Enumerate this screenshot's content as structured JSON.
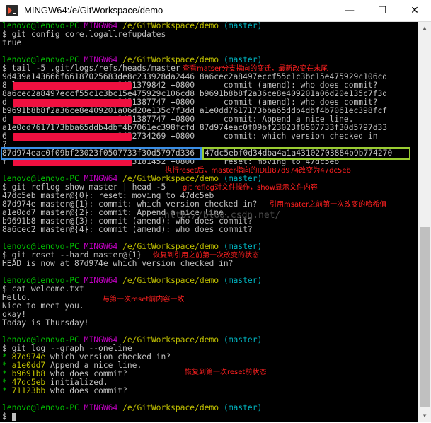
{
  "window": {
    "title": "MINGW64:/e/GitWorkspace/demo",
    "minimize": "—",
    "maximize": "☐",
    "close": "✕"
  },
  "prompt": {
    "user": "lenovo@lenovo-PC",
    "env": "MINGW64",
    "path": "/e/GitWorkspace/demo",
    "branch": "(master)",
    "symbol": "$"
  },
  "commands": {
    "c1": "git config core.logallrefupdates",
    "c2": "tail -5 .git/logs/refs/heads/master",
    "c3": "git reflog show master | head -5",
    "c4": "git reset --hard master@{1}",
    "c5": "cat welcome.txt",
    "c6": "git log --graph --oneline"
  },
  "output": {
    "o1": "true",
    "tail": [
      "9d439a143666f66187025683de8c233928da2446 8a6cec2a8497eccf55c1c3bc15e475929c106cd",
      "8 l                     1451379842 +0800      commit (amend): who does commit?",
      "8a6cec2a8497eccf55c1c3bc15e475929c106cd8 b9691b8b8f2a36ce8e409201a06d20e135c7f3d",
      "d                       1451387747 +0800      commit (amend): who does commit?",
      "b9691b8b8f2a36ce8e409201a06d20e135c7f3dd a1e0dd7617173bba65ddb4dbf4b7061ec398fcf",
      "d                       1451387747 +0800      commit: Append a nice line.",
      "a1e0dd7617173bba65ddb4dbf4b7061ec398fcfd 87d974eac0f09bf23023f0507733f30d5797d33",
      "6                       1452734269 +0800      commit: which version checked in",
      "?",
      "87d974eac0f09bf23023f0507733f30d5797d336",
      "47dc5ebf0d34dba4a1a43102703884b9b774270",
      "f                       1453181452 +0800      reset: moving to 47dc5eb"
    ],
    "reflog": [
      "47dc5eb master@{0}: reset: moving to 47dc5eb",
      "87d974e master@{1}: commit: which version checked in?",
      "a1e0dd7 master@{2}: commit: Append a nice line.",
      "b9691b8 master@{3}: commit (amend): who does commit?",
      "8a6cec2 master@{4}: commit (amend): who does commit?"
    ],
    "reset": "HEAD is now at 87d974e which version checked in?",
    "cat": [
      "Hello.",
      "Nice to meet you.",
      "okay!",
      "Today is Thursday!"
    ],
    "log": [
      {
        "hash": "87d974e",
        "msg": "which version checked in?"
      },
      {
        "hash": "a1e0dd7",
        "msg": "Append a nice line."
      },
      {
        "hash": "b9691b8",
        "msg": "who does commit?"
      },
      {
        "hash": "47dc5eb",
        "msg": "initialized."
      },
      {
        "hash": "71123bb",
        "msg": "who does commit?"
      }
    ]
  },
  "annotations": {
    "a1": "查看matser分支指向的变迁，最新改变在末尾",
    "a2": "执行reset后，master指向的ID由87d974改变为47dc5eb",
    "a3": "git reflog对文件操作，show显示文件内容",
    "a4": "引用msater之前第一次改变的哈希值",
    "a5": "恢复到引用之前第一次改变的状态",
    "a6": "与第一次reset前内容一致",
    "a7": "恢复到第一次reset前状态"
  },
  "watermark": "http://blog.csdn.net/",
  "colors": {
    "prompt_user": "#00c000",
    "prompt_env": "#c000c0",
    "prompt_path": "#c0c000",
    "prompt_branch": "#00b7c3",
    "annotation": "#ff2020",
    "box_blue": "#3a8ee6",
    "box_green": "#9acd32",
    "redaction": "#f01040"
  }
}
